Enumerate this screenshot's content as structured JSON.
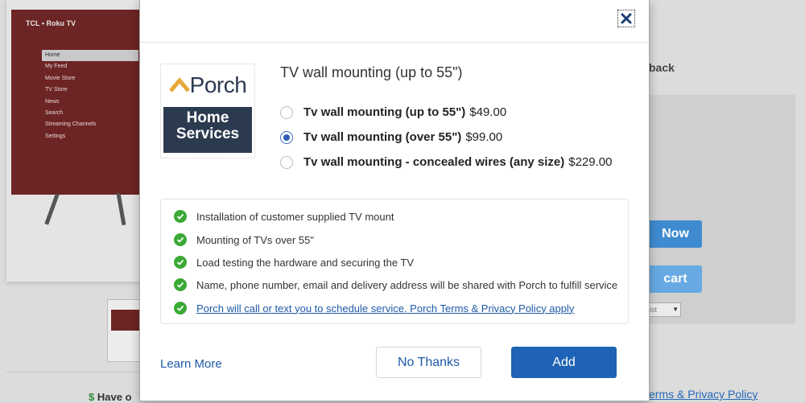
{
  "background": {
    "tv_brand": "TCL • Roku TV",
    "tv_menu": [
      "Home",
      "My Feed",
      "Movie Store",
      "TV Store",
      "News",
      "Search",
      "Streaming Channels",
      "Settings"
    ],
    "right_heading": "back",
    "buy_now_label": "Now",
    "add_to_cart_label": "cart",
    "select_value": "ist",
    "terms_link": "erms & Privacy Policy",
    "bottom_text": "Have o"
  },
  "modal": {
    "logo": {
      "brand": "Porch",
      "line1": "Home",
      "line2": "Services"
    },
    "title": "TV wall mounting (up to 55\")",
    "options": [
      {
        "name": "Tv wall mounting (up to 55\")",
        "price": "$49.00",
        "selected": false
      },
      {
        "name": "Tv wall mounting (over 55\")",
        "price": "$99.00",
        "selected": true
      },
      {
        "name": "Tv wall mounting - concealed wires (any size)",
        "price": "$229.00",
        "selected": false
      }
    ],
    "features": [
      "Installation of customer supplied TV mount",
      "Mounting of TVs over 55\"",
      "Load testing the hardware and securing the TV",
      "Name, phone number, email and delivery address will be shared with Porch to fulfill service",
      "Porch will call or text you to schedule service. Porch Terms & Privacy Policy apply"
    ],
    "learn_more": "Learn More",
    "no_thanks": "No Thanks",
    "add": "Add"
  },
  "colors": {
    "primary": "#1e63b5",
    "check": "#3aa935",
    "link": "#1f5aa6",
    "logo_navy": "#2c3a4f",
    "logo_gold": "#e9a93a"
  },
  "icons": {
    "close": "close-icon",
    "check": "checkmark-icon"
  }
}
